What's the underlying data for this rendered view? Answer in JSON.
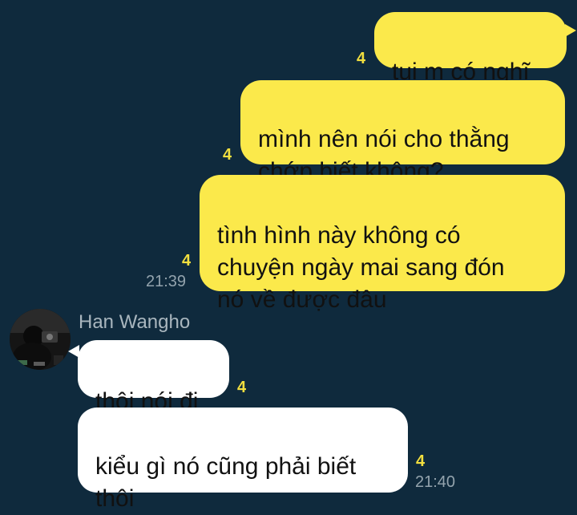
{
  "messages_out": [
    {
      "text": "tụi m có nghĩ",
      "unread": "4"
    },
    {
      "text": "mình nên nói cho thằng\nchớp biết không?",
      "unread": "4"
    },
    {
      "text": "tình hình này không có\nchuyện ngày mai sang đón\nnó về được đâu",
      "unread": "4",
      "time": "21:39"
    }
  ],
  "contact": {
    "name": "Han Wangho"
  },
  "messages_in": [
    {
      "text": "thôi nói đi",
      "unread": "4"
    },
    {
      "text": "kiểu gì nó cũng phải biết\nthôi",
      "unread": "4",
      "time": "21:40"
    }
  ],
  "colors": {
    "background": "#0f2a3d",
    "outgoing_bubble": "#fbe94b",
    "incoming_bubble": "#ffffff",
    "unread_count": "#f2df3f"
  }
}
